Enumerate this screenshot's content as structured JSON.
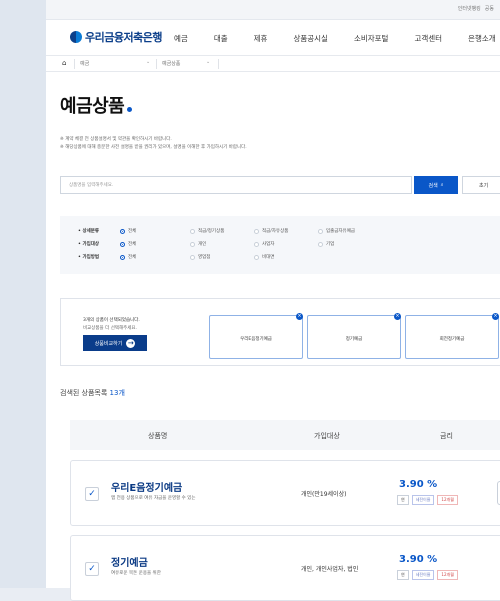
{
  "util": [
    "인터넷뱅킹",
    "공동"
  ],
  "logo": "우리금융저축은행",
  "menu": [
    "예금",
    "대출",
    "제휴",
    "상품공시실",
    "소비자포털",
    "고객센터",
    "은행소개"
  ],
  "breadcrumb": {
    "b1": "예금",
    "b2": "예금상품"
  },
  "title": "예금상품",
  "notes": [
    "※ 계약 체결 전 상품설명서 및 약관을 확인하시기 바랍니다.",
    "※ 해당상품에 대해 충분한 사전 설명을 받을 권리가 있으며, 설명을 이해한 후 가입하시기 바랍니다."
  ],
  "search": {
    "placeholder": "상품명을 입력해주세요.",
    "button": "검색",
    "reset": "초기"
  },
  "filters": [
    {
      "label": "상세분류",
      "options": [
        "전체",
        "적금/정기상품",
        "적금/자유상품",
        "입출금자유예금"
      ]
    },
    {
      "label": "가입대상",
      "options": [
        "전체",
        "개인",
        "사업자",
        "기업"
      ]
    },
    {
      "label": "가입방법",
      "options": [
        "전체",
        "영업점",
        "비대면"
      ]
    }
  ],
  "compare": {
    "count_text": "3개의 상품이 선택되었습니다.",
    "count": "3개",
    "sub": "비교상품을 더 선택해주세요.",
    "button": "상품비교하기",
    "cards": [
      "우리E음정기예금",
      "정기예금",
      "회전정기예금"
    ]
  },
  "result": {
    "label": "검색된 상품목록",
    "count": "13개"
  },
  "table": {
    "headers": [
      "상품명",
      "가입대상",
      "금리"
    ]
  },
  "products": [
    {
      "name": "우리E음정기예금",
      "desc": "앱 전용 상품으로 여유 자금을 운영할 수 있는",
      "target": "개인(만19세이상)",
      "rate": "3.90 %",
      "tags": [
        "연",
        "세전이율",
        "12개월"
      ]
    },
    {
      "name": "정기예금",
      "desc": "여유로운 목돈 운용을 위한",
      "target": "개인, 개인사업자, 법인",
      "rate": "3.90 %",
      "tags": [
        "연",
        "세전이율",
        "12개월"
      ]
    }
  ]
}
